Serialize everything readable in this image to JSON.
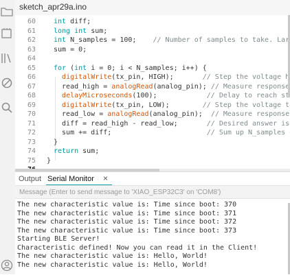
{
  "file_tab": "sketch_apr29a.ino",
  "colors": {
    "keyword": "#00979c",
    "function": "#d35400",
    "comment": "#7f8c8d",
    "accent": "#0ca1a6"
  },
  "sidebar_icons": [
    "folder-icon",
    "boards-icon",
    "library-icon",
    "debug-icon",
    "search-icon",
    "account-icon"
  ],
  "code_lines": [
    {
      "n": "60",
      "parts": [
        {
          "t": "int",
          "c": "kw"
        },
        {
          "t": " diff;",
          "c": "tx"
        }
      ]
    },
    {
      "n": "61",
      "parts": [
        {
          "t": "long int",
          "c": "kw"
        },
        {
          "t": " sum;",
          "c": "tx"
        }
      ]
    },
    {
      "n": "62",
      "parts": [
        {
          "t": "int",
          "c": "kw"
        },
        {
          "t": " N_samples = 100;    ",
          "c": "tx"
        },
        {
          "t": "// Number of samples to take. Larger num",
          "c": "cm"
        }
      ]
    },
    {
      "n": "63",
      "parts": [
        {
          "t": "sum = 0;",
          "c": "tx"
        }
      ]
    },
    {
      "n": "64",
      "parts": []
    },
    {
      "n": "65",
      "parts": [
        {
          "t": "for",
          "c": "kw"
        },
        {
          "t": " (",
          "c": "tx"
        },
        {
          "t": "int",
          "c": "kw"
        },
        {
          "t": " i = 0; i < N_samples; i++) {",
          "c": "tx"
        }
      ]
    },
    {
      "n": "66",
      "parts": [
        {
          "t": "  ",
          "c": "tx"
        },
        {
          "t": "digitalWrite",
          "c": "fn"
        },
        {
          "t": "(tx_pin, HIGH);       ",
          "c": "tx"
        },
        {
          "t": "// Step the voltage high on c",
          "c": "cm"
        }
      ]
    },
    {
      "n": "67",
      "parts": [
        {
          "t": "  read_high = ",
          "c": "tx"
        },
        {
          "t": "analogRead",
          "c": "fn"
        },
        {
          "t": "(analog_pin); ",
          "c": "tx"
        },
        {
          "t": "// Measure response of con",
          "c": "cm"
        }
      ]
    },
    {
      "n": "68",
      "parts": [
        {
          "t": "  ",
          "c": "tx"
        },
        {
          "t": "delayMicroseconds",
          "c": "fn"
        },
        {
          "t": "(100);            ",
          "c": "tx"
        },
        {
          "t": "// Delay to reach steady sta",
          "c": "cm"
        }
      ]
    },
    {
      "n": "69",
      "parts": [
        {
          "t": "  ",
          "c": "tx"
        },
        {
          "t": "digitalWrite",
          "c": "fn"
        },
        {
          "t": "(tx_pin, LOW);        ",
          "c": "tx"
        },
        {
          "t": "// Step the voltage to zero c",
          "c": "cm"
        }
      ]
    },
    {
      "n": "70",
      "parts": [
        {
          "t": "  read_low = ",
          "c": "tx"
        },
        {
          "t": "analogRead",
          "c": "fn"
        },
        {
          "t": "(analog_pin);  ",
          "c": "tx"
        },
        {
          "t": "// Measure response of con",
          "c": "cm"
        }
      ]
    },
    {
      "n": "71",
      "parts": [
        {
          "t": "  diff = read_high - read_low;       ",
          "c": "tx"
        },
        {
          "t": "// Desired answer is the diff",
          "c": "cm"
        }
      ]
    },
    {
      "n": "72",
      "parts": [
        {
          "t": "  sum += diff;                       ",
          "c": "tx"
        },
        {
          "t": "// Sum up N_samples of these",
          "c": "cm"
        }
      ]
    },
    {
      "n": "73",
      "parts": [
        {
          "t": "}",
          "c": "tx"
        }
      ]
    },
    {
      "n": "74",
      "parts": [
        {
          "t": "return",
          "c": "kw"
        },
        {
          "t": " sum;",
          "c": "tx"
        }
      ]
    },
    {
      "n": "75",
      "parts": [
        {
          "t": "}",
          "c": "tx",
          "indent": -1
        }
      ]
    },
    {
      "n": "76",
      "parts": [],
      "current": true
    }
  ],
  "panel": {
    "output_tab": "Output",
    "serial_tab": "Serial Monitor",
    "close_glyph": "×"
  },
  "serial_input_placeholder": "Message (Enter to send message to 'XIAO_ESP32C3' on 'COM8')",
  "serial_lines": [
    "The new characteristic value is: Time since boot: 370",
    "The new characteristic value is: Time since boot: 371",
    "The new characteristic value is: Time since boot: 372",
    "The new characteristic value is: Time since boot: 373",
    "Starting BLE Server!",
    "Characteristic defined! Now you can read it in the Client!",
    "The new characteristic value is: Hello, World!",
    "The new characteristic value is: Hello, World!"
  ]
}
